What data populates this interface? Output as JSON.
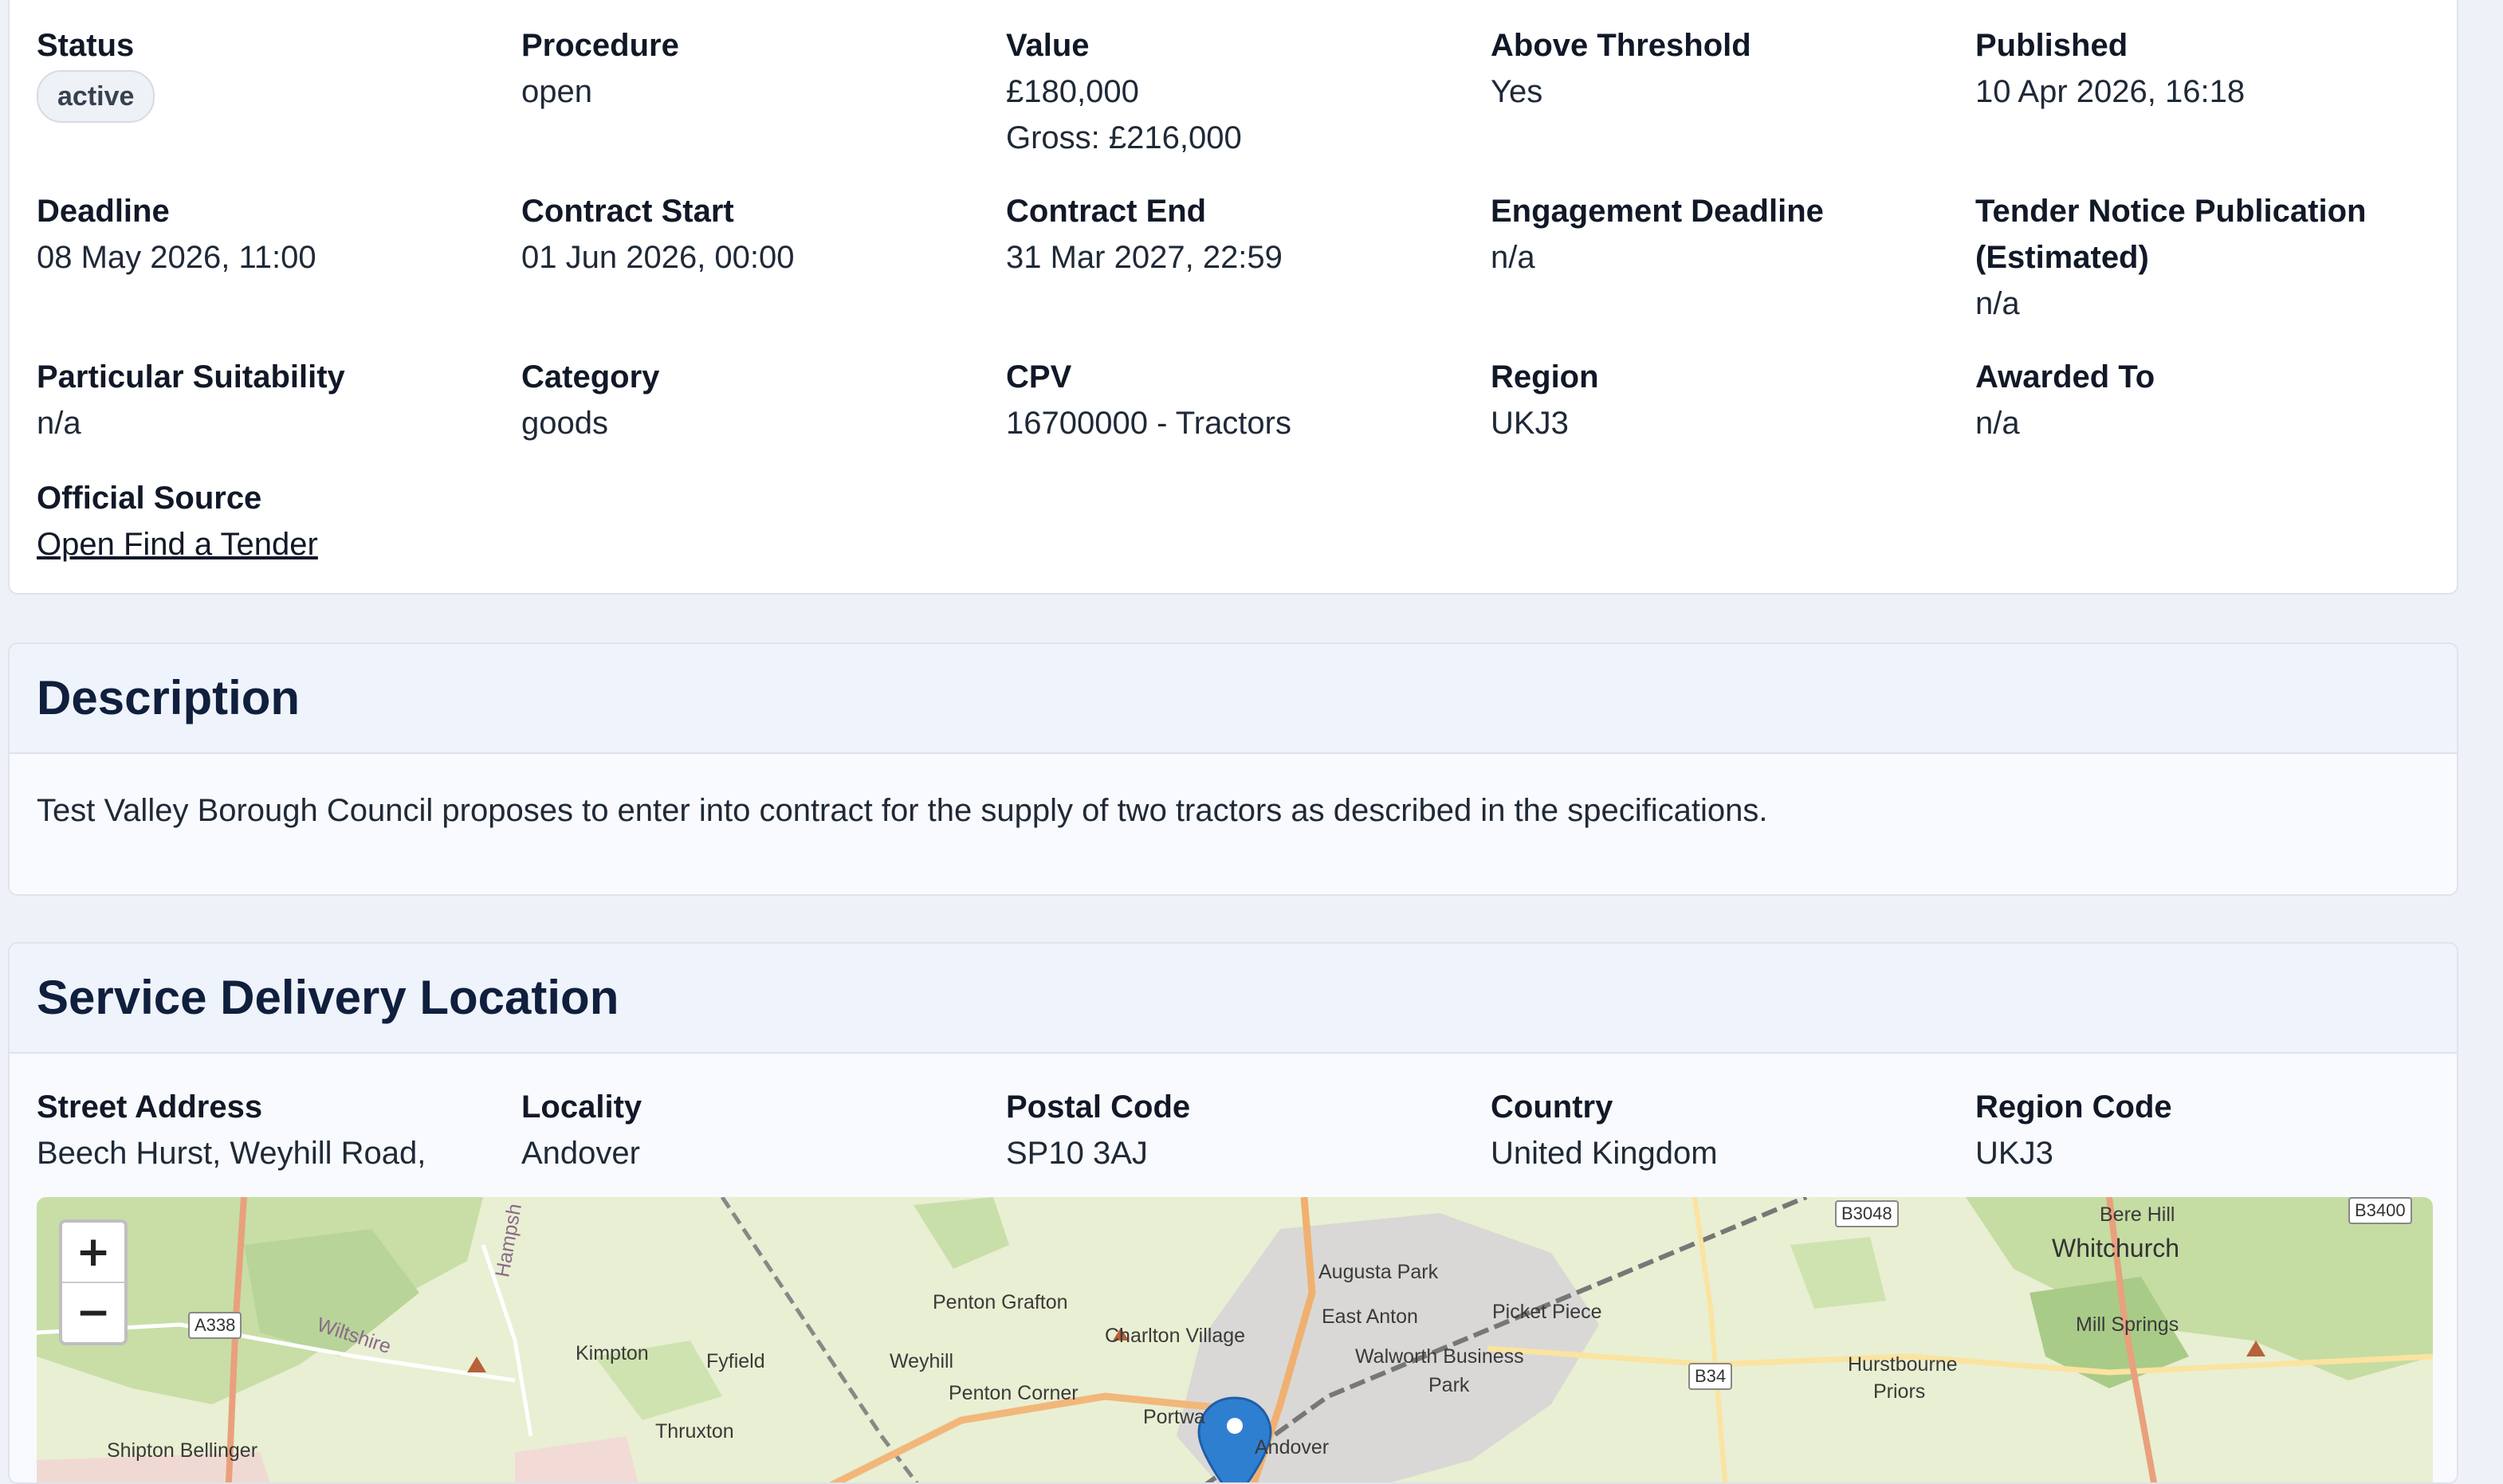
{
  "meta_fields": [
    {
      "label": "Status",
      "value": "active"
    },
    {
      "label": "Procedure",
      "value": "open"
    },
    {
      "label": "Value",
      "value": "£180,000",
      "value2": "Gross: £216,000"
    },
    {
      "label": "Above Threshold",
      "value": "Yes"
    },
    {
      "label": "Published",
      "value": "10 Apr 2026, 16:18"
    },
    {
      "label": "Deadline",
      "value": "08 May 2026, 11:00"
    },
    {
      "label": "Contract Start",
      "value": "01 Jun 2026, 00:00"
    },
    {
      "label": "Contract End",
      "value": "31 Mar 2027, 22:59"
    },
    {
      "label": "Engagement Deadline",
      "value": "n/a"
    },
    {
      "label": "Tender Notice Publication (Estimated)",
      "value": "n/a"
    },
    {
      "label": "Particular Suitability",
      "value": "n/a"
    },
    {
      "label": "Category",
      "value": "goods"
    },
    {
      "label": "CPV",
      "value": "16700000 - Tractors"
    },
    {
      "label": "Region",
      "value": "UKJ3"
    },
    {
      "label": "Awarded To",
      "value": "n/a"
    },
    {
      "label": "Official Source",
      "value": "Open Find a Tender"
    }
  ],
  "description": {
    "title": "Description",
    "text": "Test Valley Borough Council proposes to enter into contract for the supply of two tractors as described in the specifications."
  },
  "location": {
    "title": "Service Delivery Location",
    "fields": [
      {
        "label": "Street Address",
        "value": "Beech Hurst, Weyhill Road,"
      },
      {
        "label": "Locality",
        "value": "Andover"
      },
      {
        "label": "Postal Code",
        "value": "SP10 3AJ"
      },
      {
        "label": "Country",
        "value": "United Kingdom"
      },
      {
        "label": "Region Code",
        "value": "UKJ3"
      }
    ],
    "map": {
      "zoom_in": "+",
      "zoom_out": "−",
      "places": [
        "Augusta Park",
        "East Anton",
        "Picket Piece",
        "Penton Grafton",
        "Charlton Village",
        "Walworth Business",
        "Park",
        "Kimpton",
        "Fyfield",
        "Weyhill",
        "Penton Corner",
        "Portwa",
        "Thruxton",
        "Bere Hill",
        "Whitchurch",
        "Mill Springs",
        "Hurstbourne",
        "Priors",
        "Wiltshire",
        "Hampsh",
        "Shipton Bellinger",
        "Andover"
      ],
      "roads": [
        "A338",
        "B3048",
        "B3400",
        "B34"
      ]
    }
  }
}
